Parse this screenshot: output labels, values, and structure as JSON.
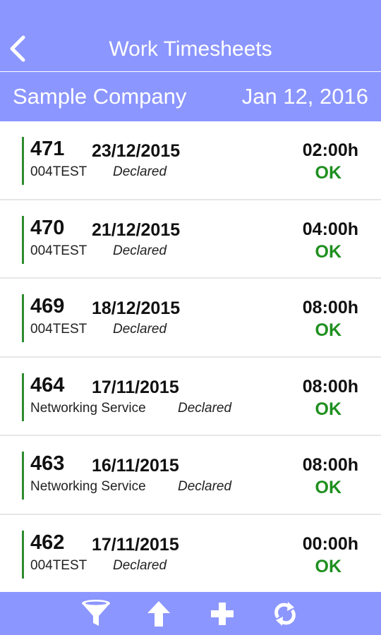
{
  "header": {
    "title": "Work Timesheets",
    "back_icon": "chevron-left-icon"
  },
  "subheader": {
    "company": "Sample Company",
    "date": "Jan 12, 2016"
  },
  "colors": {
    "bar": "#8c96ff",
    "ok": "#1f8f1f",
    "accent_line": "#2e8b2e"
  },
  "timesheets": [
    {
      "number": "471",
      "date": "23/12/2015",
      "client": "004TEST",
      "status": "Declared",
      "hours": "02:00h",
      "result": "OK"
    },
    {
      "number": "470",
      "date": "21/12/2015",
      "client": "004TEST",
      "status": "Declared",
      "hours": "04:00h",
      "result": "OK"
    },
    {
      "number": "469",
      "date": "18/12/2015",
      "client": "004TEST",
      "status": "Declared",
      "hours": "08:00h",
      "result": "OK"
    },
    {
      "number": "464",
      "date": "17/11/2015",
      "client": "Networking Service",
      "status": "Declared",
      "hours": "08:00h",
      "result": "OK"
    },
    {
      "number": "463",
      "date": "16/11/2015",
      "client": "Networking Service",
      "status": "Declared",
      "hours": "08:00h",
      "result": "OK"
    },
    {
      "number": "462",
      "date": "17/11/2015",
      "client": "004TEST",
      "status": "Declared",
      "hours": "00:00h",
      "result": "OK"
    }
  ],
  "footer": {
    "icons": [
      "filter-icon",
      "arrow-up-icon",
      "plus-icon",
      "refresh-icon"
    ]
  }
}
